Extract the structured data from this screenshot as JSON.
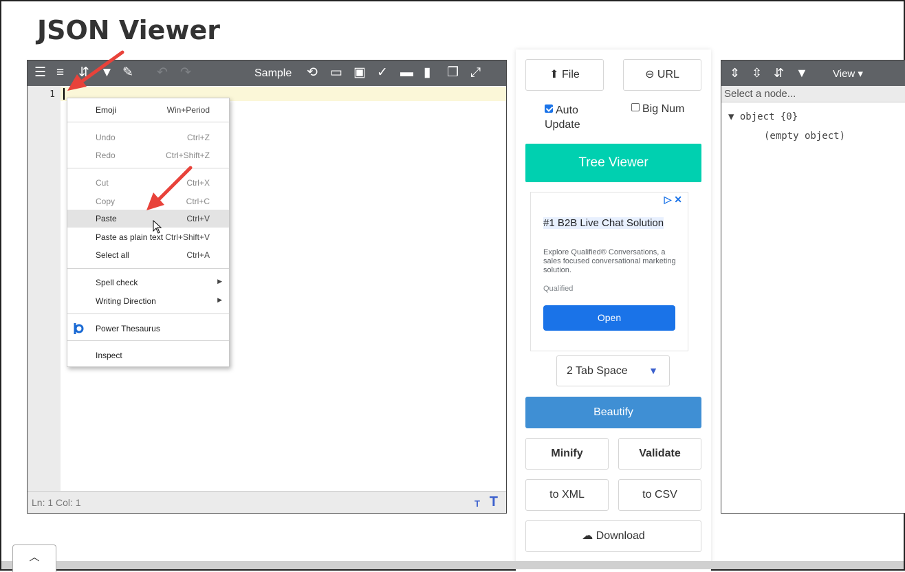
{
  "page": {
    "title": "JSON Viewer"
  },
  "editor": {
    "toolbar": {
      "icons": [
        "format-icon",
        "compact-icon",
        "sort-icon",
        "filter-icon",
        "repair-icon",
        "undo-icon",
        "redo-icon",
        "history-icon",
        "open-icon",
        "save-icon",
        "validate-icon",
        "print-icon",
        "delete-icon",
        "copy-icon",
        "fullscreen-icon"
      ],
      "sample_label": "Sample"
    },
    "line_number": "1",
    "status": "Ln: 1   Col: 1",
    "font_small": "T",
    "font_large": "T"
  },
  "context_menu": {
    "items": [
      {
        "label": "Emoji",
        "shortcut": "Win+Period"
      },
      {
        "label": "Undo",
        "shortcut": "Ctrl+Z"
      },
      {
        "label": "Redo",
        "shortcut": "Ctrl+Shift+Z"
      },
      {
        "label": "Cut",
        "shortcut": "Ctrl+X"
      },
      {
        "label": "Copy",
        "shortcut": "Ctrl+C"
      },
      {
        "label": "Paste",
        "shortcut": "Ctrl+V"
      },
      {
        "label": "Paste as plain text",
        "shortcut": "Ctrl+Shift+V"
      },
      {
        "label": "Select all",
        "shortcut": "Ctrl+A"
      },
      {
        "label": "Spell check"
      },
      {
        "label": "Writing Direction"
      },
      {
        "label": "Power Thesaurus"
      },
      {
        "label": "Inspect"
      }
    ]
  },
  "controls": {
    "file_label": "File",
    "url_label": "URL",
    "auto_update_label": "Auto Update",
    "auto_update_checked": true,
    "big_num_label": "Big Num",
    "big_num_checked": false,
    "tree_viewer_label": "Tree Viewer",
    "tab_space_value": "2 Tab Space",
    "beautify_label": "Beautify",
    "minify_label": "Minify",
    "validate_label": "Validate",
    "to_xml_label": "to XML",
    "to_csv_label": "to CSV",
    "download_label": "Download"
  },
  "ad": {
    "title": "#1 B2B Live Chat Solution",
    "body": "Explore Qualified® Conversations, a sales focused conversational marketing solution.",
    "brand": "Qualified",
    "cta": "Open"
  },
  "tree": {
    "view_label": "View ▾",
    "search_placeholder": "Select a node...",
    "root_node": "▼ object {0}",
    "empty_label": "(empty object)"
  },
  "colors": {
    "toolbar": "#5f6266",
    "tree_viewer_btn": "#00d0b0",
    "beautify_btn": "#3f8fd4",
    "ad_cta": "#1a73e8",
    "annotation_arrow": "#e8423a"
  }
}
